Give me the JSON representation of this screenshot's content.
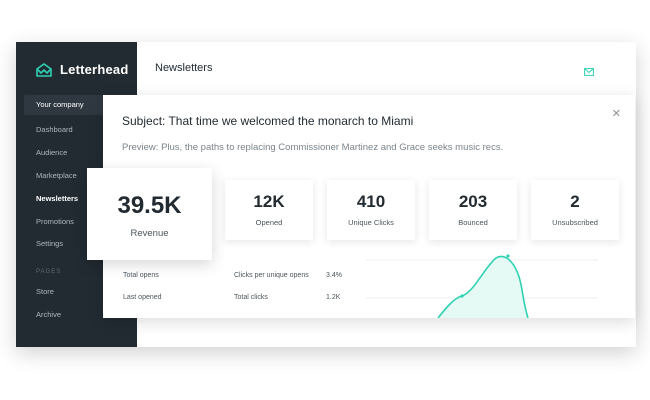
{
  "brand": {
    "name": "Letterhead",
    "accent": "#2fd1b3"
  },
  "sidebar": {
    "company": "Your company",
    "items": [
      {
        "label": "Dashboard"
      },
      {
        "label": "Audience"
      },
      {
        "label": "Marketplace"
      },
      {
        "label": "Newsletters",
        "active": true
      },
      {
        "label": "Promotions"
      },
      {
        "label": "Settings"
      }
    ],
    "section_label": "PAGES",
    "pages": [
      {
        "label": "Store"
      },
      {
        "label": "Archive"
      }
    ]
  },
  "header": {
    "title": "Newsletters",
    "icon": "envelope-icon"
  },
  "modal": {
    "subject": "Subject: That time we welcomed the monarch to Miami",
    "preview": "Preview: Plus, the paths to replacing Commissioner Martinez and Grace seeks music recs.",
    "close_icon": "close-icon",
    "revenue": {
      "value": "39.5K",
      "label": "Revenue"
    },
    "stats": [
      {
        "value": "12K",
        "label": "Opened"
      },
      {
        "value": "410",
        "label": "Unique Clicks"
      },
      {
        "value": "203",
        "label": "Bounced"
      },
      {
        "value": "2",
        "label": "Unsubscribed"
      }
    ],
    "metrics": {
      "total_opens_label": "Total opens",
      "last_opened_label": "Last opened",
      "clicks_per_unique_label": "Clicks per unique opens",
      "clicks_per_unique_value": "3.4%",
      "total_clicks_label": "Total clicks",
      "total_clicks_value": "1.2K"
    }
  }
}
